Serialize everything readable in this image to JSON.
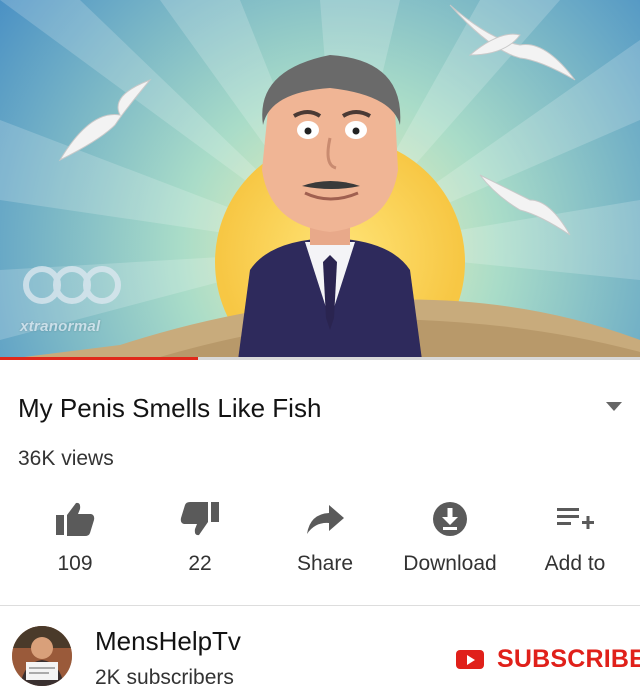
{
  "video": {
    "watermark": "xtranormal",
    "progress": 0.31
  },
  "info": {
    "title": "My Penis Smells Like Fish",
    "views": "36K views"
  },
  "actions": [
    {
      "label": "109",
      "icon": "thumbs-up-icon"
    },
    {
      "label": "22",
      "icon": "thumbs-down-icon"
    },
    {
      "label": "Share",
      "icon": "share-icon"
    },
    {
      "label": "Download",
      "icon": "download-icon"
    },
    {
      "label": "Add to",
      "icon": "playlist-add-icon"
    }
  ],
  "channel": {
    "name": "MensHelpTv",
    "subscribers": "2K subscribers",
    "subscribe_label": "SUBSCRIBE"
  },
  "colors": {
    "accent": "#e0201a",
    "text": "#131313",
    "secondary_text": "#333333",
    "icon": "#5a5a5a"
  }
}
